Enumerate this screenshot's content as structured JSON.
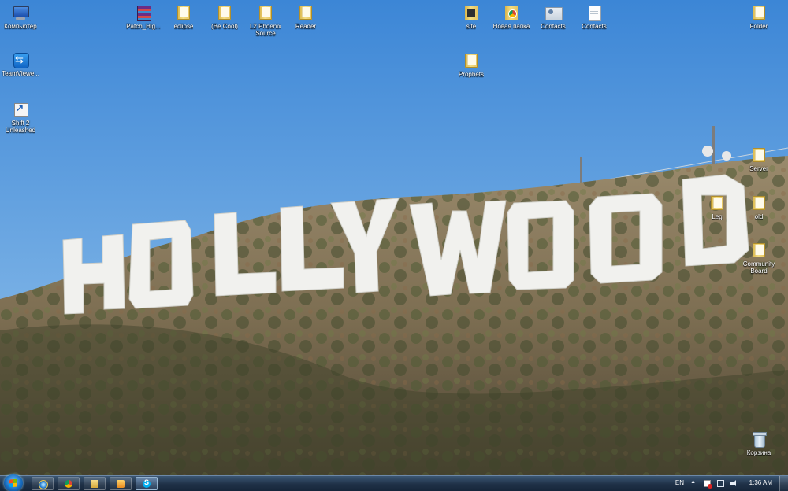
{
  "desktop": {
    "wallpaper_text": "HOLLYWOOD",
    "icons": {
      "computer": "Компьютер",
      "teamviewer": "TeamViewe...",
      "shift2": "Shift 2\nUnleashed",
      "patch": "Patch_Hig...",
      "eclipse": "eclipse",
      "be_cool": "(Be Cool)",
      "l2_phoenix": "L2 Phoenix\nSource",
      "reader": "Reader",
      "site": "site",
      "new_folder": "Новая папка",
      "contacts_1": "Contacts",
      "contacts_2": "Contacts",
      "folder": "Folder",
      "prophets": "Prophets",
      "server": "Server",
      "leg": "Leg",
      "old": "old",
      "community_board": "Community\nBoard",
      "recycle_bin": "Корзина"
    }
  },
  "taskbar": {
    "language": "EN",
    "clock": "1:36 AM"
  },
  "colors": {
    "sky_top": "#3c86d6",
    "sky_bottom": "#8cc0ea",
    "hill": "#8a7a5e",
    "letters": "#f1f1ee",
    "taskbar": "#1f3147"
  }
}
